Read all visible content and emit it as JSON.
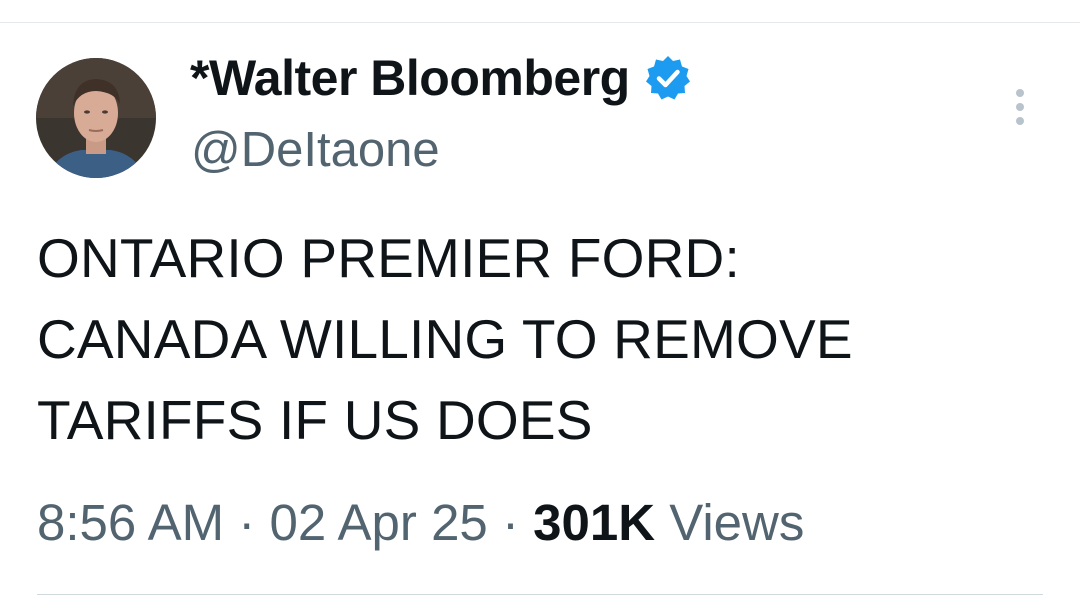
{
  "tweet": {
    "author": {
      "display_name": "*Walter Bloomberg",
      "handle": "@DeItaone",
      "verified": true,
      "badge_color": "#1d9bf0"
    },
    "text_lines": [
      "ONTARIO PREMIER FORD:",
      "CANADA WILLING TO REMOVE",
      "TARIFFS IF US DOES"
    ],
    "meta": {
      "time": "8:56 AM",
      "separator": "·",
      "date": "02 Apr 25",
      "views_count": "301K",
      "views_label": "Views"
    },
    "icons": {
      "verified": "verified-badge-icon",
      "more": "more-options-icon"
    }
  }
}
